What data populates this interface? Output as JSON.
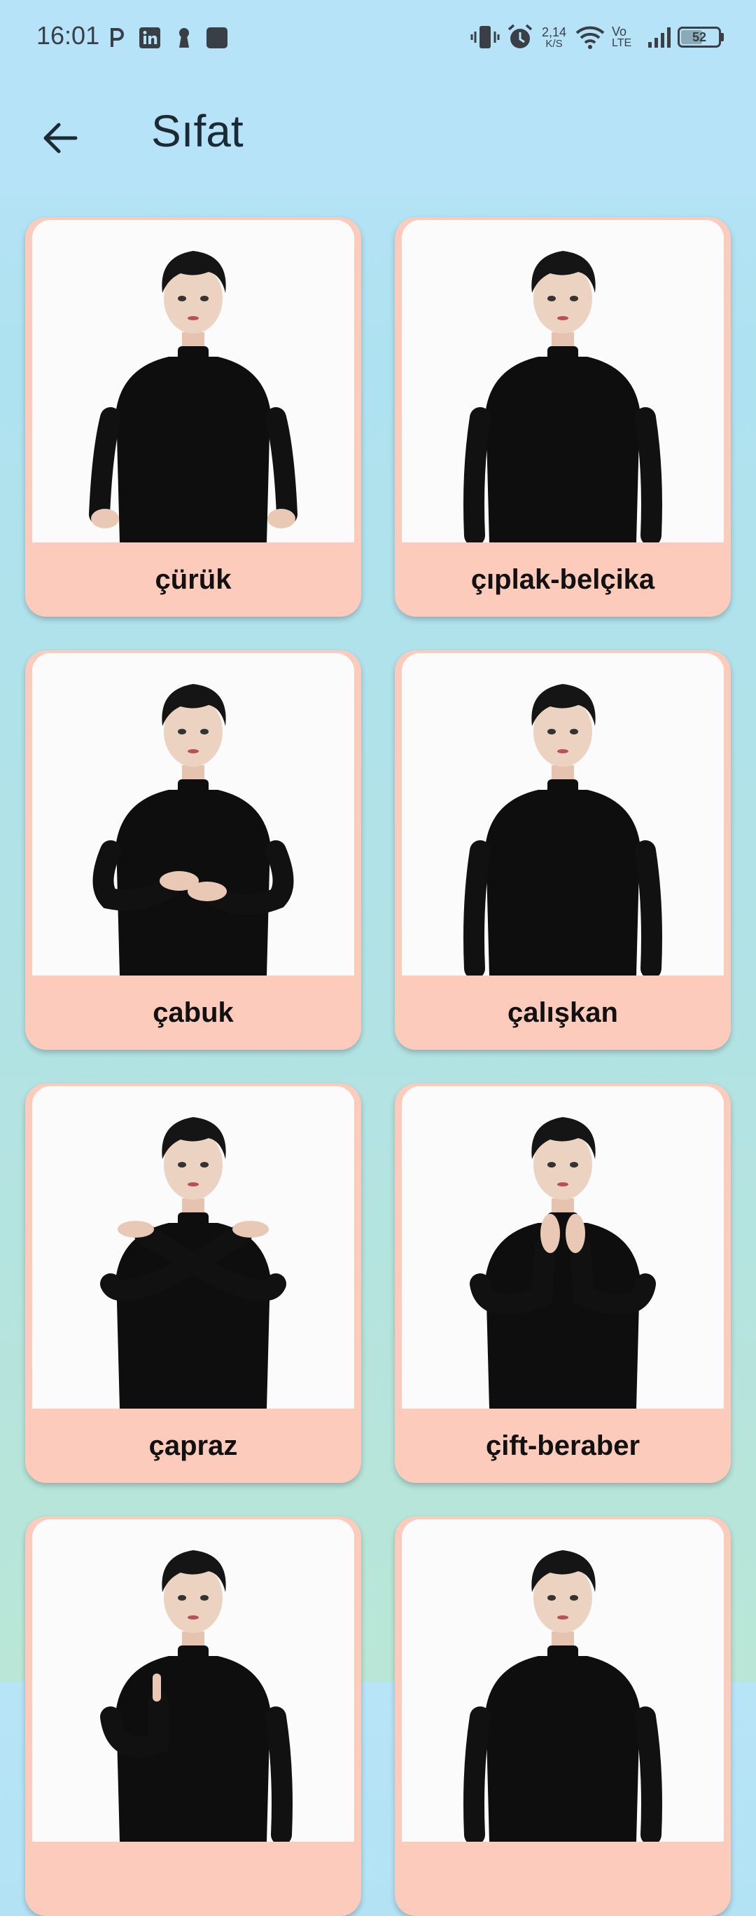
{
  "status_bar": {
    "time": "16:01",
    "net_speed_value": "2,14",
    "net_speed_unit": "K/S",
    "volte_top": "Vo",
    "volte_bottom": "LTE",
    "battery_level": "52"
  },
  "app_bar": {
    "title": "Sıfat"
  },
  "cards": [
    {
      "label": "çürük",
      "pose": "hands-low"
    },
    {
      "label": "çıplak-belçika",
      "pose": "arms-down"
    },
    {
      "label": "çabuk",
      "pose": "hands-chest"
    },
    {
      "label": "çalışkan",
      "pose": "arms-down"
    },
    {
      "label": "çapraz",
      "pose": "arms-crossed"
    },
    {
      "label": "çift-beraber",
      "pose": "hands-up-chest"
    },
    {
      "label": "",
      "pose": "finger-up"
    },
    {
      "label": "",
      "pose": "arms-down"
    }
  ],
  "colors": {
    "app_bar_bg": "#b6e3f8",
    "card_bg": "#fccbbb",
    "title_text": "#1c2a33"
  }
}
